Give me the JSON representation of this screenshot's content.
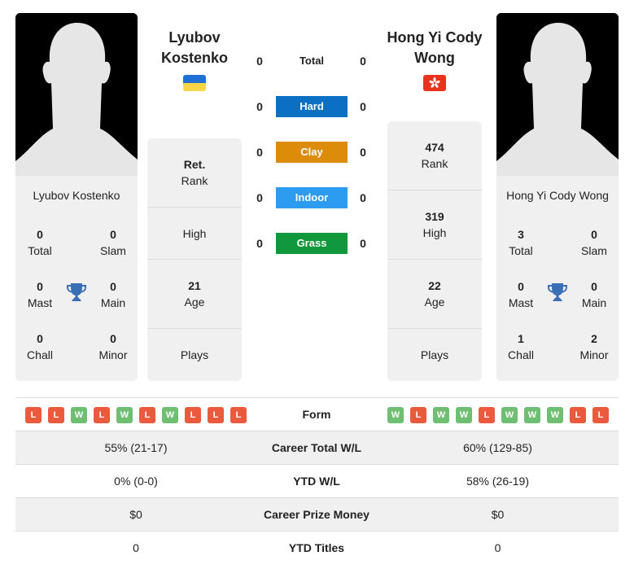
{
  "player1": {
    "name": "Lyubov Kostenko",
    "name_line1": "Lyubov",
    "name_line2": "Kostenko",
    "country_flag": "ukraine-flag",
    "stats": {
      "total": {
        "value": "0",
        "label": "Total"
      },
      "slam": {
        "value": "0",
        "label": "Slam"
      },
      "mast": {
        "value": "0",
        "label": "Mast"
      },
      "main": {
        "value": "0",
        "label": "Main"
      },
      "chall": {
        "value": "0",
        "label": "Chall"
      },
      "minor": {
        "value": "0",
        "label": "Minor"
      }
    },
    "info": {
      "rank": {
        "value": "Ret.",
        "label": "Rank"
      },
      "high": {
        "value": "",
        "label": "High"
      },
      "age": {
        "value": "21",
        "label": "Age"
      },
      "plays": {
        "value": "",
        "label": "Plays"
      }
    },
    "form": [
      "L",
      "L",
      "W",
      "L",
      "W",
      "L",
      "W",
      "L",
      "L",
      "L"
    ]
  },
  "player2": {
    "name": "Hong Yi Cody Wong",
    "name_line1": "Hong Yi Cody",
    "name_line2": "Wong",
    "country_flag": "hong-kong-flag",
    "stats": {
      "total": {
        "value": "3",
        "label": "Total"
      },
      "slam": {
        "value": "0",
        "label": "Slam"
      },
      "mast": {
        "value": "0",
        "label": "Mast"
      },
      "main": {
        "value": "0",
        "label": "Main"
      },
      "chall": {
        "value": "1",
        "label": "Chall"
      },
      "minor": {
        "value": "2",
        "label": "Minor"
      }
    },
    "info": {
      "rank": {
        "value": "474",
        "label": "Rank"
      },
      "high": {
        "value": "319",
        "label": "High"
      },
      "age": {
        "value": "22",
        "label": "Age"
      },
      "plays": {
        "value": "",
        "label": "Plays"
      }
    },
    "form": [
      "W",
      "L",
      "W",
      "W",
      "L",
      "W",
      "W",
      "W",
      "L",
      "L"
    ]
  },
  "head_to_head": {
    "total": {
      "label": "Total",
      "p1": "0",
      "p2": "0"
    },
    "surfaces": [
      {
        "label": "Hard",
        "p1": "0",
        "p2": "0",
        "color": "#0b6fc2"
      },
      {
        "label": "Clay",
        "p1": "0",
        "p2": "0",
        "color": "#dd8c0a"
      },
      {
        "label": "Indoor",
        "p1": "0",
        "p2": "0",
        "color": "#2d9bf0"
      },
      {
        "label": "Grass",
        "p1": "0",
        "p2": "0",
        "color": "#12983c"
      }
    ]
  },
  "comparison": {
    "form_label": "Form",
    "rows": [
      {
        "label": "Career Total W/L",
        "p1": "55% (21-17)",
        "p2": "60% (129-85)"
      },
      {
        "label": "YTD W/L",
        "p1": "0% (0-0)",
        "p2": "58% (26-19)"
      },
      {
        "label": "Career Prize Money",
        "p1": "$0",
        "p2": "$0"
      },
      {
        "label": "YTD Titles",
        "p1": "0",
        "p2": "0"
      }
    ]
  },
  "colors": {
    "win": "#6fbf73",
    "loss": "#ec5a3d",
    "trophy": "#3a6fb5",
    "card_bg": "#f0f0f0"
  }
}
